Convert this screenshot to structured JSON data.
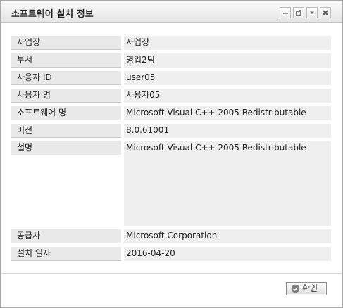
{
  "dialog": {
    "title": "소프트웨어 설치 정보"
  },
  "fields": [
    {
      "label": "사업장",
      "value": "사업장"
    },
    {
      "label": "부서",
      "value": "영업2팀"
    },
    {
      "label": "사용자 ID",
      "value": "user05"
    },
    {
      "label": "사용자 명",
      "value": "사용자05"
    },
    {
      "label": "소프트웨어 명",
      "value": "Microsoft Visual C++ 2005 Redistributable"
    },
    {
      "label": "버전",
      "value": "8.0.61001"
    },
    {
      "label": "설명",
      "value": "Microsoft Visual C++ 2005 Redistributable"
    },
    {
      "label": "공급사",
      "value": "Microsoft Corporation"
    },
    {
      "label": "설치 일자",
      "value": "2016-04-20"
    }
  ],
  "footer": {
    "ok_label": "확인"
  },
  "icons": {
    "minimize": "minimize-icon",
    "popout": "popout-icon",
    "dropdown": "chevron-down-icon",
    "close": "close-icon",
    "ok": "check-circle-icon"
  }
}
